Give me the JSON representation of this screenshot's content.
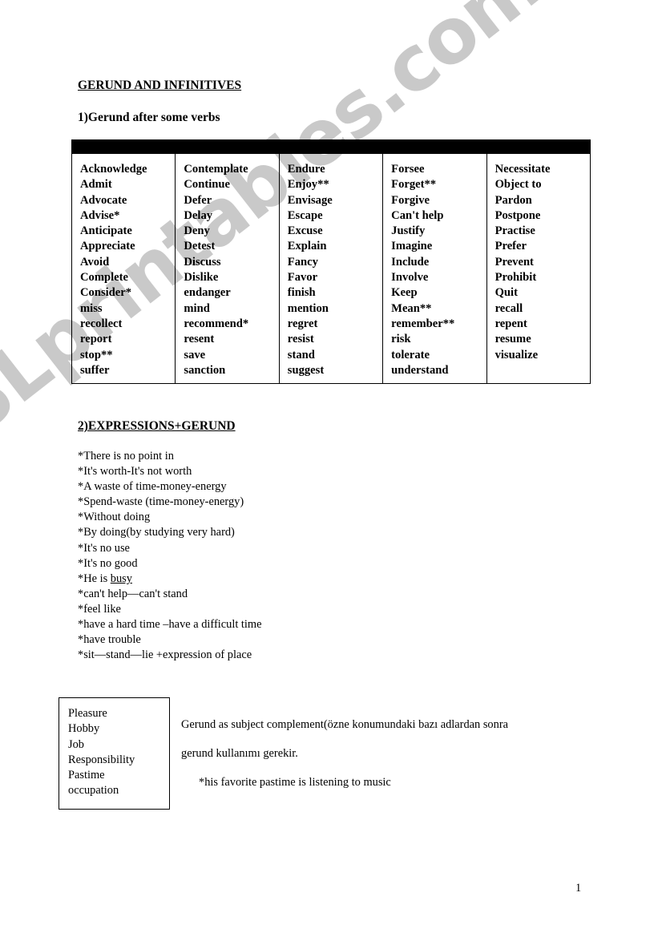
{
  "document": {
    "title": "GERUND AND INFINITIVES",
    "page_number": "1",
    "watermark": "ESLprintables.com"
  },
  "section1": {
    "heading": "1)Gerund after some verbs",
    "table": {
      "header_row_empty": true,
      "columns": [
        {
          "items": [
            "Acknowledge",
            "Admit",
            "Advocate",
            "Advise*",
            "Anticipate",
            "Appreciate",
            "Avoid",
            "Complete",
            "Consider*",
            "miss",
            "recollect",
            "report",
            "stop**",
            "suffer"
          ]
        },
        {
          "items": [
            "Contemplate",
            "Continue",
            "Defer",
            "Delay",
            "Deny",
            "Detest",
            "Discuss",
            "Dislike",
            "endanger",
            "mind",
            "recommend*",
            "resent",
            "save",
            "sanction"
          ]
        },
        {
          "items": [
            "Endure",
            "Enjoy**",
            "Envisage",
            "Escape",
            "Excuse",
            "Explain",
            "Fancy",
            "Favor",
            "finish",
            "mention",
            "regret",
            "resist",
            "stand",
            "suggest"
          ]
        },
        {
          "items": [
            "Forsee",
            "Forget**",
            "Forgive",
            "Can't help",
            "Justify",
            "Imagine",
            "Include",
            "Involve",
            "Keep",
            "Mean**",
            "remember**",
            "risk",
            "tolerate",
            "understand"
          ]
        },
        {
          "items": [
            "Necessitate",
            "Object to",
            "Pardon",
            "Postpone",
            "Practise",
            "Prefer",
            "Prevent",
            "Prohibit",
            "Quit",
            "recall",
            "repent",
            "resume",
            "visualize"
          ]
        }
      ]
    }
  },
  "section2": {
    "heading": "2)EXPRESSIONS+GERUND",
    "expressions": [
      {
        "text": "*There is no point in"
      },
      {
        "text": "*It's worth-It's not worth"
      },
      {
        "text": "*A waste of time-money-energy"
      },
      {
        "text": "*Spend-waste (time-money-energy)"
      },
      {
        "text": "*Without doing"
      },
      {
        "text": "*By doing(by studying very hard)"
      },
      {
        "text": "*It's no use"
      },
      {
        "text": "*It's no good"
      },
      {
        "prefix": "*He is ",
        "underlined": "busy"
      },
      {
        "text": "*can't help—can't stand"
      },
      {
        "text": "*feel like"
      },
      {
        "text": "*have a hard time –have a difficult time"
      },
      {
        "text": "*have trouble"
      },
      {
        "text": "*sit—stand—lie +expression of place"
      }
    ]
  },
  "section3": {
    "noun_box": {
      "items": [
        "Pleasure",
        "Hobby",
        "Job",
        "Responsibility",
        "Pastime",
        "occupation"
      ]
    },
    "explanation_line1": "Gerund as subject complement(özne konumundaki bazı adlardan sonra",
    "explanation_line2": "gerund kullanımı gerekir.",
    "example": "*his favorite pastime is listening to music"
  }
}
